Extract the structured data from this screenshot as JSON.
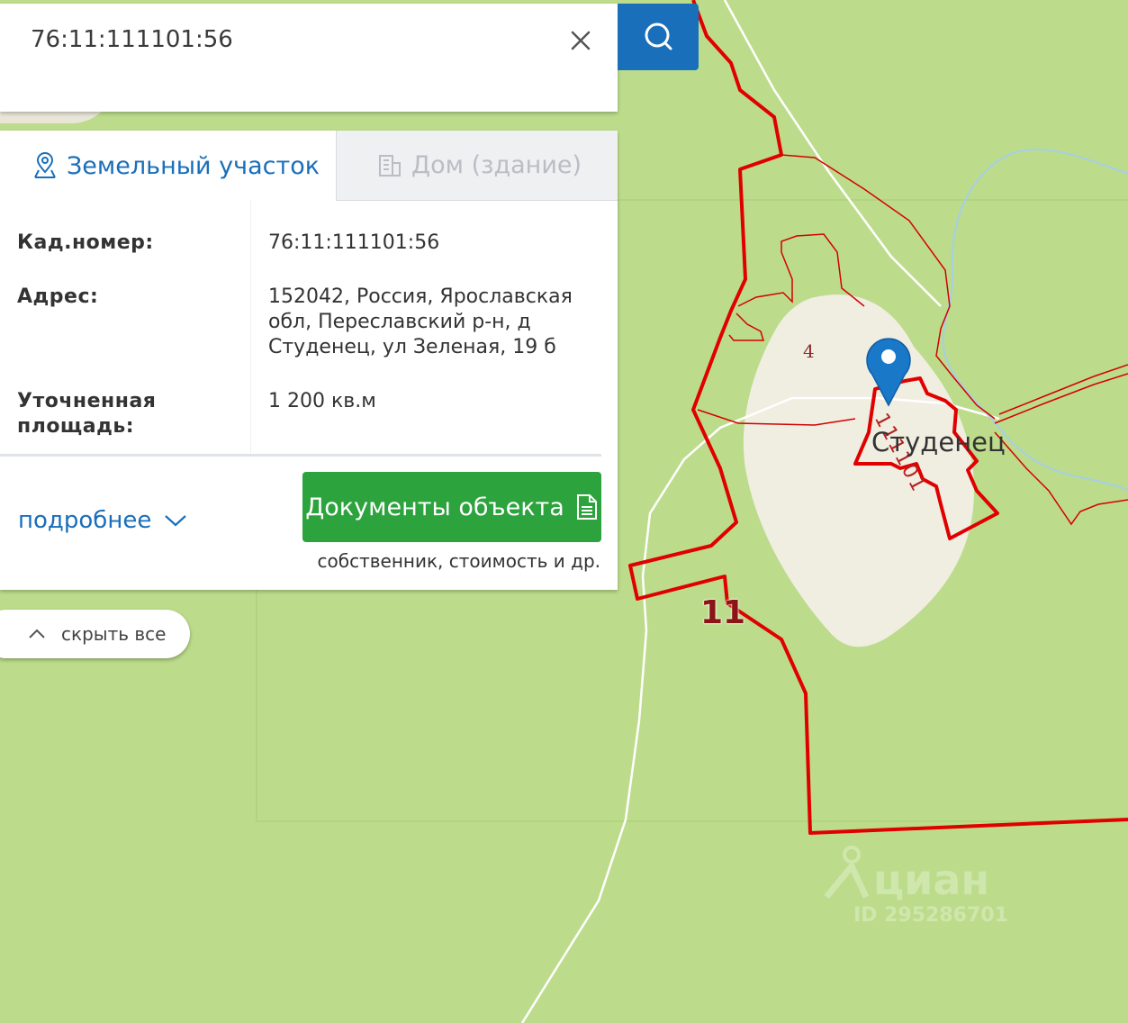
{
  "search": {
    "value": "76:11:111101:56",
    "clear_icon": "close-icon",
    "search_icon": "search-icon",
    "accent_color": "#1a6fba"
  },
  "tabs": [
    {
      "label": "Земельный участок",
      "icon": "map-pin-outline-icon",
      "active": true
    },
    {
      "label": "Дом (здание)",
      "icon": "building-icon",
      "active": false
    }
  ],
  "info": {
    "rows": [
      {
        "label": "Кад.номер:",
        "value": "76:11:111101:56"
      },
      {
        "label": "Адрес:",
        "value": "152042, Россия, Ярославская обл, Переславский р-н, д Студенец, ул Зеленая, 19 б"
      },
      {
        "label": "Уточненная площадь:",
        "value": "1 200 кв.м"
      }
    ]
  },
  "actions": {
    "more_label": "подробнее",
    "documents_label": "Документы объекта",
    "documents_note": "собственник, стоимость и др.",
    "documents_color": "#2ca33d"
  },
  "hide_all": {
    "label": "скрыть все"
  },
  "map": {
    "village_label": "Студенец",
    "district_number": "11",
    "block_number": "4",
    "parcel_label": "111101",
    "watermark_brand": "циан",
    "watermark_id": "ID 295286701",
    "boundary_color": "#e00000",
    "land_color": "#bcdc8b",
    "settlement_color": "#f0ede1"
  }
}
